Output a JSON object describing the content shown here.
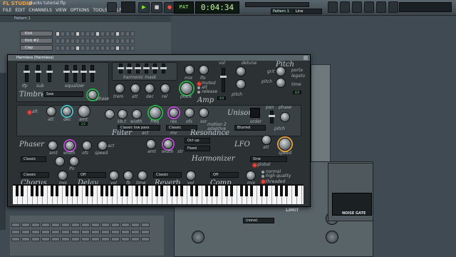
{
  "app": {
    "logo": "FL STUDIO",
    "project_file": "plucks tutorial.flp",
    "hint": "Harmless"
  },
  "menu": [
    "FILE",
    "EDIT",
    "CHANNELS",
    "VIEW",
    "OPTIONS",
    "TOOLS",
    "HELP"
  ],
  "transport": {
    "pat_label": "PAT",
    "time": "0:04:34",
    "pattern_label": "Pattern 1",
    "line_label": "Line"
  },
  "sequencer": {
    "title": "Pattern 1",
    "channels": [
      {
        "name": "Kick",
        "steps": [
          1,
          0,
          0,
          0,
          1,
          0,
          0,
          0,
          1,
          0,
          0,
          0,
          1,
          0,
          0,
          0
        ]
      },
      {
        "name": "Kick #2",
        "steps": [
          0,
          0,
          0,
          0,
          0,
          0,
          0,
          0,
          0,
          0,
          0,
          0,
          0,
          0,
          0,
          0
        ]
      },
      {
        "name": "Clap",
        "steps": [
          0,
          0,
          0,
          0,
          1,
          0,
          0,
          0,
          0,
          0,
          0,
          0,
          1,
          0,
          0,
          0
        ]
      }
    ]
  },
  "plugin": {
    "title": "Harmless (Harmless)",
    "sections": {
      "timbre": "Timbre",
      "amp": "Amp",
      "pitch": "Pitch",
      "filter": "Filter",
      "resonance": "Resonance",
      "unison": "Unison",
      "phaser": "Phaser",
      "harmonizer": "Harmonizer",
      "lfo": "LFO",
      "chorus": "Chorus",
      "delay": "Delay",
      "reverb": "Reverb",
      "comp": "Comp"
    },
    "labels": {
      "lfp": "lfp",
      "sub": "sub",
      "equalizer": "equalizer",
      "harmonic_mask": "harmonic mask",
      "mix": "mix",
      "lfo": "lfo",
      "vol": "vol",
      "detune": "detune",
      "grit": "grit",
      "pitch": "pitch",
      "porta": "porta",
      "legato": "legato",
      "time": "time",
      "trem": "trem",
      "att": "att",
      "dec": "dec",
      "rel": "rel",
      "pluck": "pluck",
      "muted": "muted",
      "alt": "alt",
      "release": "release",
      "phase": "phase",
      "amt": "amt",
      "kb_t": "kb.t",
      "freq": "freq",
      "res": "res",
      "ofs": "ofs",
      "sor": "sor",
      "order": "order",
      "pan": "pan",
      "act": "act",
      "mv": "mv",
      "motion": "motion 2",
      "adaptive": "adaptive",
      "width": "width",
      "speed": "speed",
      "str": "str",
      "global": "global",
      "fb": "fb",
      "normal": "normal",
      "hq": "high quality",
      "threaded": "threaded"
    },
    "dropdowns": {
      "timbre": "Saw",
      "filter": "Classic low pass",
      "filter2": "Classic",
      "unison": "Blurred",
      "phaser": "Classic",
      "harm1": "Oct up",
      "harm2": "Fixed",
      "lfo": "Sine",
      "chorus": "Classic",
      "delay": "Off",
      "reverb": "Classic",
      "comp": "Off"
    },
    "leds": {
      "a": "4/4",
      "b": "4/4",
      "c": "1/1",
      "d": "1/1"
    }
  },
  "background_plugin": {
    "label_a": "LIMIT",
    "label_b": "NOISE GATE",
    "preset": "(none)"
  },
  "colors": {
    "accent_green": "#2bb24c",
    "accent_purple": "#b84bd0",
    "accent_orange": "#e6a23a",
    "led_red": "#ff3b2b",
    "lcd_green": "#c9f6a3"
  }
}
